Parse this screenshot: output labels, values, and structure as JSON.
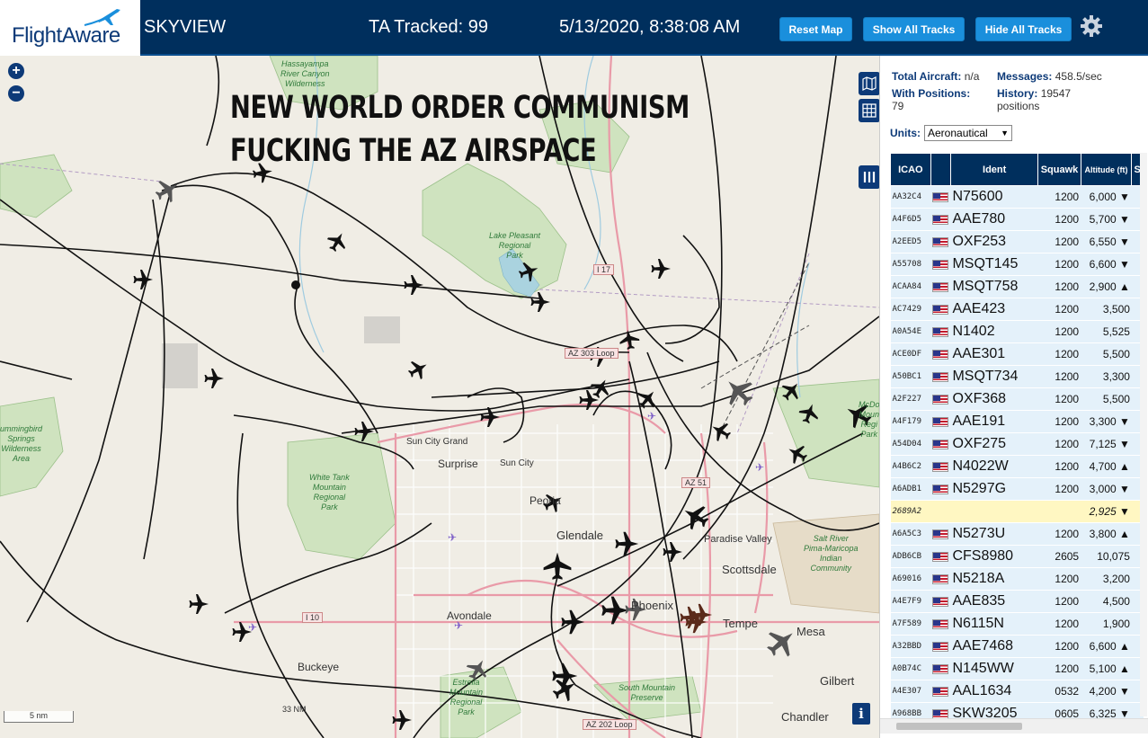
{
  "header": {
    "logo_text": "FlightAware",
    "app_title": "SKYVIEW",
    "tracked": "TA Tracked: 99",
    "datetime": "5/13/2020, 8:38:08 AM",
    "buttons": {
      "reset": "Reset Map",
      "show_all": "Show All Tracks",
      "hide_all": "Hide All Tracks"
    }
  },
  "map": {
    "overlay_line1": "NEW WORLD ORDER COMMUNISM",
    "overlay_line2": "FUCKING THE AZ AIRSPACE",
    "zoom_in": "+",
    "zoom_out": "−",
    "scale_label": "5 nm",
    "range_label": "33 NM",
    "info": "i",
    "places": {
      "surprise": "Surprise",
      "sun_city": "Sun City",
      "sun_city_grand": "Sun City Grand",
      "peoria": "Peoria",
      "glendale": "Glendale",
      "paradise_valley": "Paradise Valley",
      "scottsdale": "Scottsdale",
      "phoenix": "Phoenix",
      "tempe": "Tempe",
      "mesa": "Mesa",
      "avondale": "Avondale",
      "buckeye": "Buckeye",
      "gilbert": "Gilbert",
      "chandler": "Chandler"
    },
    "parks": {
      "hassayampa": "Hassayampa\nRiver Canyon\nWilderness",
      "lake_pleasant": "Lake Pleasant\nRegional\nPark",
      "hummingbird": "ummingbird\nSprings\nWilderness\nArea",
      "white_tank": "White Tank\nMountain\nRegional\nPark",
      "estrella": "Estrella\nMountain\nRegional\nPark",
      "south_mountain": "South Mountain\nPreserve",
      "salt_river": "Salt River\nPima-Maricopa\nIndian\nCommunity",
      "mcdowell": "McDo\nMoun\nRegi\nPark"
    },
    "roads": {
      "i17": "I 17",
      "az303": "AZ 303 Loop",
      "az51": "AZ 51",
      "i10": "I 10",
      "az202": "AZ 202 Loop"
    }
  },
  "sidebar": {
    "total_aircraft_label": "Total Aircraft:",
    "total_aircraft_value": "n/a",
    "messages_label": "Messages:",
    "messages_value": "458.5/sec",
    "with_positions_label": "With Positions:",
    "with_positions_value": "79",
    "history_label": "History:",
    "history_value": "19547 positions",
    "units_label": "Units:",
    "units_value": "Aeronautical",
    "columns": {
      "icao": "ICAO",
      "ident": "Ident",
      "squawk": "Squawk",
      "altitude": "Altitude (ft)",
      "speed": "S"
    },
    "rows": [
      {
        "icao": "AA32C4",
        "ident": "N75600",
        "squawk": "1200",
        "alt": "6,000 ▼",
        "flag": true
      },
      {
        "icao": "A4F6D5",
        "ident": "AAE780",
        "squawk": "1200",
        "alt": "5,700 ▼",
        "flag": true
      },
      {
        "icao": "A2EED5",
        "ident": "OXF253",
        "squawk": "1200",
        "alt": "6,550 ▼",
        "flag": true
      },
      {
        "icao": "A55708",
        "ident": "MSQT145",
        "squawk": "1200",
        "alt": "6,600 ▼",
        "flag": true
      },
      {
        "icao": "ACAA84",
        "ident": "MSQT758",
        "squawk": "1200",
        "alt": "2,900 ▲",
        "flag": true
      },
      {
        "icao": "AC7429",
        "ident": "AAE423",
        "squawk": "1200",
        "alt": "3,500",
        "flag": true
      },
      {
        "icao": "A0A54E",
        "ident": "N1402",
        "squawk": "1200",
        "alt": "5,525",
        "flag": true
      },
      {
        "icao": "ACE0DF",
        "ident": "AAE301",
        "squawk": "1200",
        "alt": "5,500",
        "flag": true
      },
      {
        "icao": "A50BC1",
        "ident": "MSQT734",
        "squawk": "1200",
        "alt": "3,300",
        "flag": true
      },
      {
        "icao": "A2F227",
        "ident": "OXF368",
        "squawk": "1200",
        "alt": "5,500",
        "flag": true
      },
      {
        "icao": "A4F179",
        "ident": "AAE191",
        "squawk": "1200",
        "alt": "3,300 ▼",
        "flag": true
      },
      {
        "icao": "A54D04",
        "ident": "OXF275",
        "squawk": "1200",
        "alt": "7,125 ▼",
        "flag": true
      },
      {
        "icao": "A4B6C2",
        "ident": "N4022W",
        "squawk": "1200",
        "alt": "4,700 ▲",
        "flag": true
      },
      {
        "icao": "A6ADB1",
        "ident": "N5297G",
        "squawk": "1200",
        "alt": "3,000 ▼",
        "flag": true
      },
      {
        "icao": "2689A2",
        "ident": "",
        "squawk": "",
        "alt": "2,925 ▼",
        "flag": false,
        "selected": true
      },
      {
        "icao": "A6A5C3",
        "ident": "N5273U",
        "squawk": "1200",
        "alt": "3,800 ▲",
        "flag": true
      },
      {
        "icao": "ADB6CB",
        "ident": "CFS8980",
        "squawk": "2605",
        "alt": "10,075",
        "flag": true
      },
      {
        "icao": "A69016",
        "ident": "N5218A",
        "squawk": "1200",
        "alt": "3,200",
        "flag": true
      },
      {
        "icao": "A4E7F9",
        "ident": "AAE835",
        "squawk": "1200",
        "alt": "4,500",
        "flag": true
      },
      {
        "icao": "A7F589",
        "ident": "N6115N",
        "squawk": "1200",
        "alt": "1,900",
        "flag": true
      },
      {
        "icao": "A32BBD",
        "ident": "AAE7468",
        "squawk": "1200",
        "alt": "6,600 ▲",
        "flag": true
      },
      {
        "icao": "A0B74C",
        "ident": "N145WW",
        "squawk": "1200",
        "alt": "5,100 ▲",
        "flag": true
      },
      {
        "icao": "A4E307",
        "ident": "AAL1634",
        "squawk": "0532",
        "alt": "4,200 ▼",
        "flag": true
      },
      {
        "icao": "A968BB",
        "ident": "SKW3205",
        "squawk": "0605",
        "alt": "6,325 ▼",
        "flag": true
      }
    ]
  },
  "colors": {
    "header_bg": "#002f5d",
    "button_bg": "#1a8fdc",
    "table_row": "#e4f1fa",
    "selected_row": "#fff7c2"
  }
}
